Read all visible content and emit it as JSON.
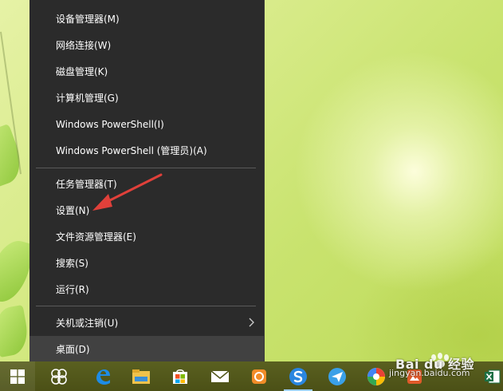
{
  "menu": {
    "items": [
      {
        "label": "设备管理器(M)"
      },
      {
        "label": "网络连接(W)"
      },
      {
        "label": "磁盘管理(K)"
      },
      {
        "label": "计算机管理(G)"
      },
      {
        "label": "Windows PowerShell(I)"
      },
      {
        "label": "Windows PowerShell (管理员)(A)"
      },
      {
        "label": "任务管理器(T)"
      },
      {
        "label": "设置(N)"
      },
      {
        "label": "文件资源管理器(E)"
      },
      {
        "label": "搜索(S)"
      },
      {
        "label": "运行(R)"
      },
      {
        "label": "关机或注销(U)",
        "has_submenu": true
      },
      {
        "label": "桌面(D)",
        "selected": true
      }
    ]
  },
  "taskbar": {
    "icons": [
      {
        "name": "windows-start-icon"
      },
      {
        "name": "task-view-icon"
      },
      {
        "name": "edge-browser-icon"
      },
      {
        "name": "file-explorer-icon"
      },
      {
        "name": "store-icon"
      },
      {
        "name": "mail-icon"
      },
      {
        "name": "photo-app-icon"
      },
      {
        "name": "sogou-browser-icon"
      },
      {
        "name": "paper-plane-app-icon"
      },
      {
        "name": "pinwheel-app-icon"
      },
      {
        "name": "image-viewer-icon"
      },
      {
        "name": "excel-icon"
      }
    ]
  },
  "watermark": {
    "brand": "Bai du 经验",
    "url": "jingyan.baidu.com"
  },
  "colors": {
    "menu_bg": "#2b2b2b",
    "menu_selected": "#414141",
    "annotation_arrow": "#e0403a",
    "taskbar_bg": "#52571a"
  }
}
